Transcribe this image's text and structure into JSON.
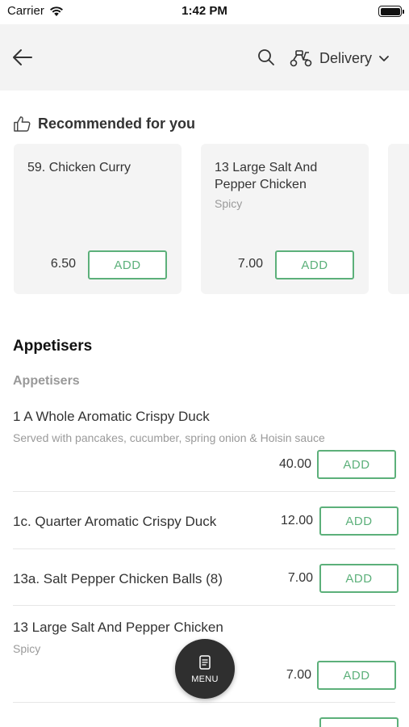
{
  "status": {
    "carrier": "Carrier",
    "time": "1:42 PM"
  },
  "header": {
    "delivery_label": "Delivery"
  },
  "recommended": {
    "title": "Recommended for you",
    "cards": [
      {
        "name": "59. Chicken Curry",
        "subtitle": "",
        "price": "6.50",
        "add_label": "ADD"
      },
      {
        "name": "13 Large Salt And Pepper Chicken",
        "subtitle": "Spicy",
        "price": "7.00",
        "add_label": "ADD"
      }
    ]
  },
  "menu": {
    "section_title": "Appetisers",
    "subsection_title": "Appetisers",
    "items": [
      {
        "name": "1 A Whole Aromatic Crispy Duck",
        "description": "Served with pancakes, cucumber, spring onion & Hoisin sauce",
        "price": "40.00",
        "add_label": "ADD"
      },
      {
        "name": "1c. Quarter Aromatic Crispy Duck",
        "description": "",
        "price": "12.00",
        "add_label": "ADD"
      },
      {
        "name": "13a. Salt Pepper Chicken Balls (8)",
        "description": "",
        "price": "7.00",
        "add_label": "ADD"
      },
      {
        "name": "13 Large Salt And Pepper Chicken",
        "description": "Spicy",
        "price": "7.00",
        "add_label": "ADD"
      }
    ]
  },
  "fab": {
    "label": "MENU"
  },
  "colors": {
    "accent": "#5cb07a",
    "header_bg": "#f3f3f3",
    "card_bg": "#f4f4f4",
    "fab_bg": "#2f2f2f"
  }
}
